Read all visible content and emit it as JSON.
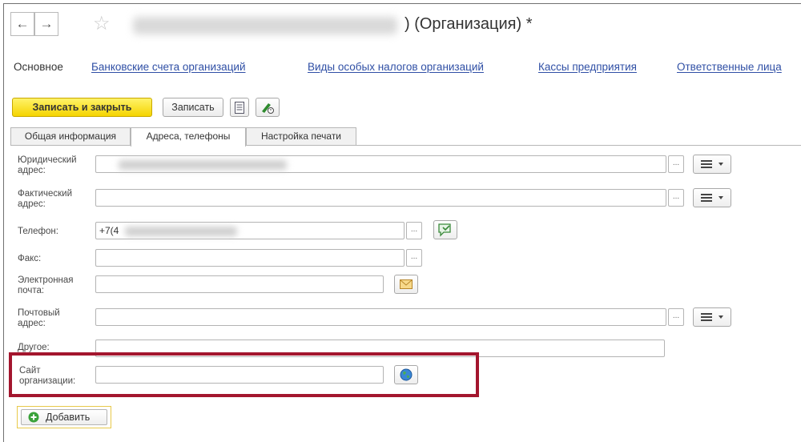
{
  "window": {
    "back_icon": "←",
    "forward_icon": "→",
    "favorite_icon": "☆",
    "title_suffix": ") (Организация) *"
  },
  "nav_tabs": [
    {
      "label": "Основное",
      "active": true
    },
    {
      "label": "Банковские счета организаций",
      "active": false
    },
    {
      "label": "Виды особых налогов организаций",
      "active": false
    },
    {
      "label": "Кассы предприятия",
      "active": false
    },
    {
      "label": "Ответственные лица",
      "active": false
    }
  ],
  "toolbar": {
    "save_close_label": "Записать и закрыть",
    "save_label": "Записать"
  },
  "form_tabs": [
    {
      "label": "Общая информация",
      "active": false
    },
    {
      "label": "Адреса, телефоны",
      "active": true
    },
    {
      "label": "Настройка печати",
      "active": false
    }
  ],
  "fields": {
    "legal_address": {
      "label_1": "Юридический",
      "label_2": "адрес:"
    },
    "actual_address": {
      "label_1": "Фактический",
      "label_2": "адрес:"
    },
    "phone": {
      "label": "Телефон:",
      "value": "+7(4"
    },
    "fax": {
      "label": "Факс:"
    },
    "email": {
      "label_1": "Электронная",
      "label_2": "почта:"
    },
    "postal_address": {
      "label_1": "Почтовый",
      "label_2": "адрес:"
    },
    "other": {
      "label": "Другое:"
    },
    "website": {
      "label_1": "Сайт",
      "label_2": "организации:"
    }
  },
  "dots_label": "...",
  "add_button": {
    "label": "Добавить"
  },
  "colors": {
    "accent_yellow": "#f5d400",
    "highlight_red": "#a3162e",
    "link_blue": "#2f4fa5"
  }
}
